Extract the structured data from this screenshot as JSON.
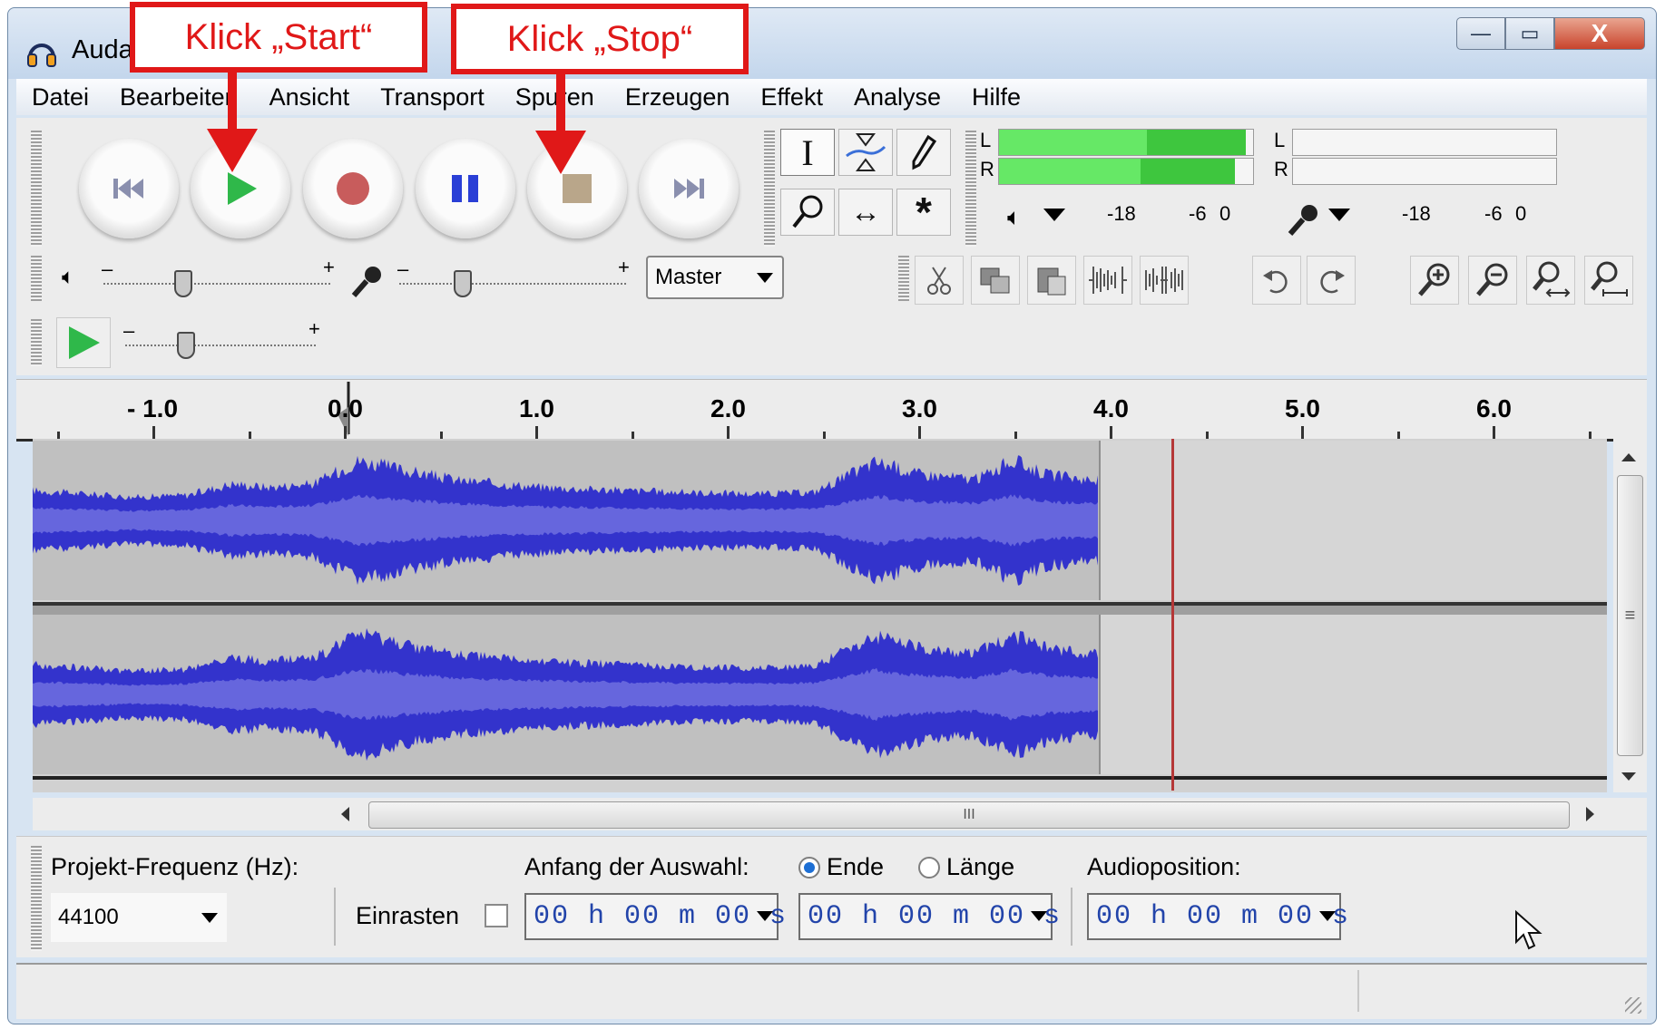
{
  "window": {
    "title": "Auda",
    "buttons": [
      "—",
      "▭",
      "X"
    ]
  },
  "menu": [
    "Datei",
    "Bearbeiten",
    "Ansicht",
    "Transport",
    "Spuren",
    "Erzeugen",
    "Effekt",
    "Analyse",
    "Hilfe"
  ],
  "transport": {
    "buttons": [
      "skip-to-start",
      "play",
      "record",
      "pause",
      "stop",
      "skip-to-end"
    ]
  },
  "tools": [
    "selection-tool",
    "envelope-tool",
    "draw-tool",
    "zoom-tool",
    "timeshift-tool",
    "multi-tool"
  ],
  "meters": {
    "playback_channels": [
      "L",
      "R"
    ],
    "record_channels": [
      "L",
      "R"
    ],
    "scale_playback": [
      "-18",
      "-6",
      "0"
    ],
    "scale_record": [
      "-18",
      "-6",
      "0"
    ],
    "playback_level_L": 0.97,
    "playback_level_R": 0.93
  },
  "mixer": {
    "minus": "–",
    "plus": "+",
    "input_source": "Master",
    "output_volume": 0.35,
    "input_volume": 0.28,
    "play_speed": 0.32
  },
  "edit_buttons": [
    "cut-icon",
    "copy-icon",
    "paste-icon",
    "trim-icon",
    "silence-icon",
    "undo-icon",
    "redo-icon",
    "zoom-in-icon",
    "zoom-out-icon",
    "fit-selection-icon",
    "fit-project-icon"
  ],
  "ruler": {
    "labels": [
      "- 1.0",
      "0.0",
      "1.0",
      "2.0",
      "3.0",
      "4.0",
      "5.0",
      "6.0"
    ]
  },
  "scroll": {
    "h_grip": "III",
    "v_grip": "≡"
  },
  "selection": {
    "project_rate_label": "Projekt-Frequenz (Hz):",
    "project_rate_value": "44100",
    "snap_label": "Einrasten",
    "start_label": "Anfang der Auswahl:",
    "end_option": "Ende",
    "length_option": "Länge",
    "audio_position_label": "Audioposition:",
    "start_time": "00 h 00 m 00 s",
    "end_time": "00 h 00 m 00 s",
    "position_time": "00 h 00 m 00 s"
  },
  "annotations": {
    "start": "Klick „Start“",
    "stop": "Klick „Stop“"
  },
  "colors": {
    "waveform": "#3333cc",
    "waveform_rms": "#6666dd",
    "annotation": "#e01818",
    "play": "#2fb84a",
    "record": "#c85c5c",
    "pause": "#2a3fd6",
    "stop": "#b9a68a"
  }
}
